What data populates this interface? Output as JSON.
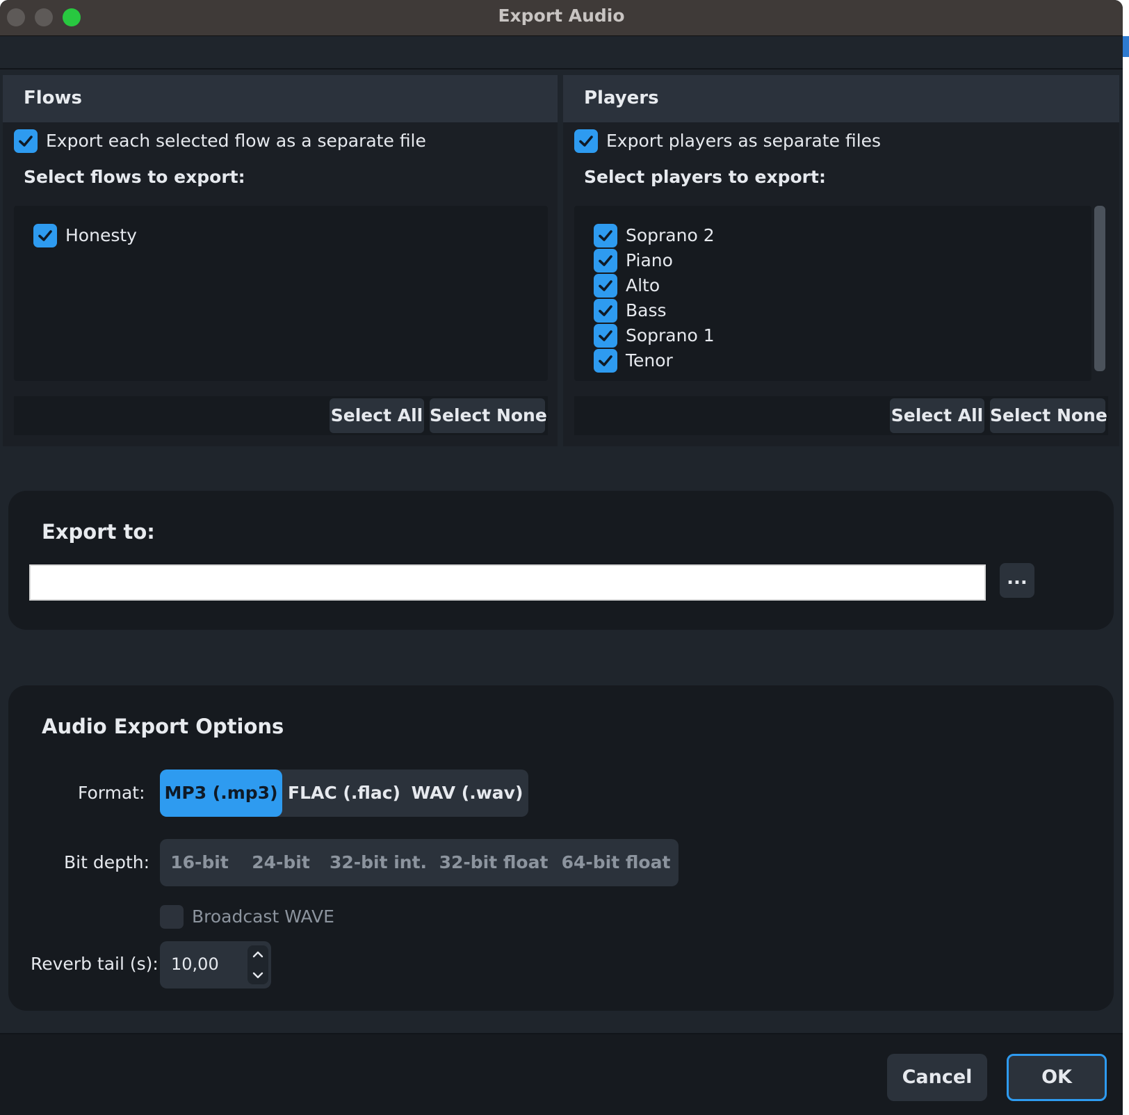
{
  "window": {
    "title": "Export Audio"
  },
  "flows": {
    "heading": "Flows",
    "separate_label": "Export each selected flow as a separate file",
    "separate_checked": true,
    "select_label": "Select flows to export:",
    "items": [
      {
        "label": "Honesty",
        "checked": true
      }
    ],
    "select_all": "Select All",
    "select_none": "Select None"
  },
  "players": {
    "heading": "Players",
    "separate_label": "Export players as separate files",
    "separate_checked": true,
    "select_label": "Select players to export:",
    "items": [
      {
        "label": "Soprano 2",
        "checked": true
      },
      {
        "label": "Piano",
        "checked": true
      },
      {
        "label": "Alto",
        "checked": true
      },
      {
        "label": "Bass",
        "checked": true
      },
      {
        "label": "Soprano 1",
        "checked": true
      },
      {
        "label": "Tenor",
        "checked": true
      }
    ],
    "select_all": "Select All",
    "select_none": "Select None"
  },
  "export_to": {
    "heading": "Export to:",
    "path_value": "",
    "browse_label": "..."
  },
  "options": {
    "heading": "Audio Export Options",
    "format_label": "Format:",
    "formats": [
      "MP3 (.mp3)",
      "FLAC (.flac)",
      "WAV (.wav)"
    ],
    "selected_format": "MP3 (.mp3)",
    "bit_depth_label": "Bit depth:",
    "bit_depths": [
      "16-bit",
      "24-bit",
      "32-bit int.",
      "32-bit float",
      "64-bit float"
    ],
    "broadcast_label": "Broadcast WAVE",
    "broadcast_checked": false,
    "reverb_label": "Reverb tail (s):",
    "reverb_value": "10,00"
  },
  "buttons": {
    "cancel": "Cancel",
    "ok": "OK"
  },
  "colors": {
    "accent": "#2e9bf0",
    "background": "#1f252c",
    "panel": "#161a1f"
  }
}
